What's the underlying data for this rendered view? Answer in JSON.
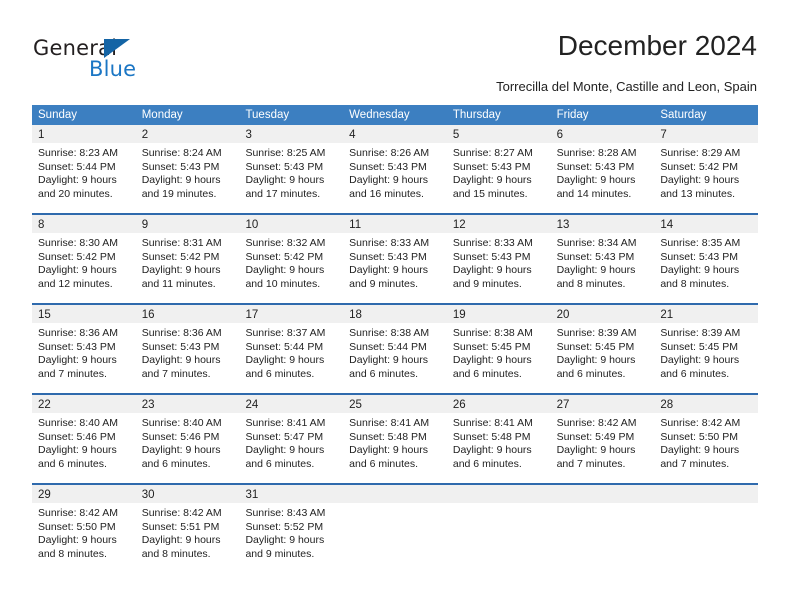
{
  "brand": {
    "name_part1": "General",
    "name_part2": "Blue",
    "accent_color": "#1b76c4",
    "triangle_color": "#1464a5"
  },
  "header": {
    "title": "December 2024",
    "subtitle": "Torrecilla del Monte, Castille and Leon, Spain"
  },
  "calendar": {
    "header_bg": "#3c7fc1",
    "daynum_bg": "#f0f0f0",
    "row_divider_color": "#2f6aad",
    "weekdays": [
      "Sunday",
      "Monday",
      "Tuesday",
      "Wednesday",
      "Thursday",
      "Friday",
      "Saturday"
    ],
    "weeks": [
      [
        {
          "day": "1",
          "sunrise": "Sunrise: 8:23 AM",
          "sunset": "Sunset: 5:44 PM",
          "daylight1": "Daylight: 9 hours",
          "daylight2": "and 20 minutes."
        },
        {
          "day": "2",
          "sunrise": "Sunrise: 8:24 AM",
          "sunset": "Sunset: 5:43 PM",
          "daylight1": "Daylight: 9 hours",
          "daylight2": "and 19 minutes."
        },
        {
          "day": "3",
          "sunrise": "Sunrise: 8:25 AM",
          "sunset": "Sunset: 5:43 PM",
          "daylight1": "Daylight: 9 hours",
          "daylight2": "and 17 minutes."
        },
        {
          "day": "4",
          "sunrise": "Sunrise: 8:26 AM",
          "sunset": "Sunset: 5:43 PM",
          "daylight1": "Daylight: 9 hours",
          "daylight2": "and 16 minutes."
        },
        {
          "day": "5",
          "sunrise": "Sunrise: 8:27 AM",
          "sunset": "Sunset: 5:43 PM",
          "daylight1": "Daylight: 9 hours",
          "daylight2": "and 15 minutes."
        },
        {
          "day": "6",
          "sunrise": "Sunrise: 8:28 AM",
          "sunset": "Sunset: 5:43 PM",
          "daylight1": "Daylight: 9 hours",
          "daylight2": "and 14 minutes."
        },
        {
          "day": "7",
          "sunrise": "Sunrise: 8:29 AM",
          "sunset": "Sunset: 5:42 PM",
          "daylight1": "Daylight: 9 hours",
          "daylight2": "and 13 minutes."
        }
      ],
      [
        {
          "day": "8",
          "sunrise": "Sunrise: 8:30 AM",
          "sunset": "Sunset: 5:42 PM",
          "daylight1": "Daylight: 9 hours",
          "daylight2": "and 12 minutes."
        },
        {
          "day": "9",
          "sunrise": "Sunrise: 8:31 AM",
          "sunset": "Sunset: 5:42 PM",
          "daylight1": "Daylight: 9 hours",
          "daylight2": "and 11 minutes."
        },
        {
          "day": "10",
          "sunrise": "Sunrise: 8:32 AM",
          "sunset": "Sunset: 5:42 PM",
          "daylight1": "Daylight: 9 hours",
          "daylight2": "and 10 minutes."
        },
        {
          "day": "11",
          "sunrise": "Sunrise: 8:33 AM",
          "sunset": "Sunset: 5:43 PM",
          "daylight1": "Daylight: 9 hours",
          "daylight2": "and 9 minutes."
        },
        {
          "day": "12",
          "sunrise": "Sunrise: 8:33 AM",
          "sunset": "Sunset: 5:43 PM",
          "daylight1": "Daylight: 9 hours",
          "daylight2": "and 9 minutes."
        },
        {
          "day": "13",
          "sunrise": "Sunrise: 8:34 AM",
          "sunset": "Sunset: 5:43 PM",
          "daylight1": "Daylight: 9 hours",
          "daylight2": "and 8 minutes."
        },
        {
          "day": "14",
          "sunrise": "Sunrise: 8:35 AM",
          "sunset": "Sunset: 5:43 PM",
          "daylight1": "Daylight: 9 hours",
          "daylight2": "and 8 minutes."
        }
      ],
      [
        {
          "day": "15",
          "sunrise": "Sunrise: 8:36 AM",
          "sunset": "Sunset: 5:43 PM",
          "daylight1": "Daylight: 9 hours",
          "daylight2": "and 7 minutes."
        },
        {
          "day": "16",
          "sunrise": "Sunrise: 8:36 AM",
          "sunset": "Sunset: 5:43 PM",
          "daylight1": "Daylight: 9 hours",
          "daylight2": "and 7 minutes."
        },
        {
          "day": "17",
          "sunrise": "Sunrise: 8:37 AM",
          "sunset": "Sunset: 5:44 PM",
          "daylight1": "Daylight: 9 hours",
          "daylight2": "and 6 minutes."
        },
        {
          "day": "18",
          "sunrise": "Sunrise: 8:38 AM",
          "sunset": "Sunset: 5:44 PM",
          "daylight1": "Daylight: 9 hours",
          "daylight2": "and 6 minutes."
        },
        {
          "day": "19",
          "sunrise": "Sunrise: 8:38 AM",
          "sunset": "Sunset: 5:45 PM",
          "daylight1": "Daylight: 9 hours",
          "daylight2": "and 6 minutes."
        },
        {
          "day": "20",
          "sunrise": "Sunrise: 8:39 AM",
          "sunset": "Sunset: 5:45 PM",
          "daylight1": "Daylight: 9 hours",
          "daylight2": "and 6 minutes."
        },
        {
          "day": "21",
          "sunrise": "Sunrise: 8:39 AM",
          "sunset": "Sunset: 5:45 PM",
          "daylight1": "Daylight: 9 hours",
          "daylight2": "and 6 minutes."
        }
      ],
      [
        {
          "day": "22",
          "sunrise": "Sunrise: 8:40 AM",
          "sunset": "Sunset: 5:46 PM",
          "daylight1": "Daylight: 9 hours",
          "daylight2": "and 6 minutes."
        },
        {
          "day": "23",
          "sunrise": "Sunrise: 8:40 AM",
          "sunset": "Sunset: 5:46 PM",
          "daylight1": "Daylight: 9 hours",
          "daylight2": "and 6 minutes."
        },
        {
          "day": "24",
          "sunrise": "Sunrise: 8:41 AM",
          "sunset": "Sunset: 5:47 PM",
          "daylight1": "Daylight: 9 hours",
          "daylight2": "and 6 minutes."
        },
        {
          "day": "25",
          "sunrise": "Sunrise: 8:41 AM",
          "sunset": "Sunset: 5:48 PM",
          "daylight1": "Daylight: 9 hours",
          "daylight2": "and 6 minutes."
        },
        {
          "day": "26",
          "sunrise": "Sunrise: 8:41 AM",
          "sunset": "Sunset: 5:48 PM",
          "daylight1": "Daylight: 9 hours",
          "daylight2": "and 6 minutes."
        },
        {
          "day": "27",
          "sunrise": "Sunrise: 8:42 AM",
          "sunset": "Sunset: 5:49 PM",
          "daylight1": "Daylight: 9 hours",
          "daylight2": "and 7 minutes."
        },
        {
          "day": "28",
          "sunrise": "Sunrise: 8:42 AM",
          "sunset": "Sunset: 5:50 PM",
          "daylight1": "Daylight: 9 hours",
          "daylight2": "and 7 minutes."
        }
      ],
      [
        {
          "day": "29",
          "sunrise": "Sunrise: 8:42 AM",
          "sunset": "Sunset: 5:50 PM",
          "daylight1": "Daylight: 9 hours",
          "daylight2": "and 8 minutes."
        },
        {
          "day": "30",
          "sunrise": "Sunrise: 8:42 AM",
          "sunset": "Sunset: 5:51 PM",
          "daylight1": "Daylight: 9 hours",
          "daylight2": "and 8 minutes."
        },
        {
          "day": "31",
          "sunrise": "Sunrise: 8:43 AM",
          "sunset": "Sunset: 5:52 PM",
          "daylight1": "Daylight: 9 hours",
          "daylight2": "and 9 minutes."
        },
        {
          "day": "",
          "sunrise": "",
          "sunset": "",
          "daylight1": "",
          "daylight2": ""
        },
        {
          "day": "",
          "sunrise": "",
          "sunset": "",
          "daylight1": "",
          "daylight2": ""
        },
        {
          "day": "",
          "sunrise": "",
          "sunset": "",
          "daylight1": "",
          "daylight2": ""
        },
        {
          "day": "",
          "sunrise": "",
          "sunset": "",
          "daylight1": "",
          "daylight2": ""
        }
      ]
    ]
  }
}
